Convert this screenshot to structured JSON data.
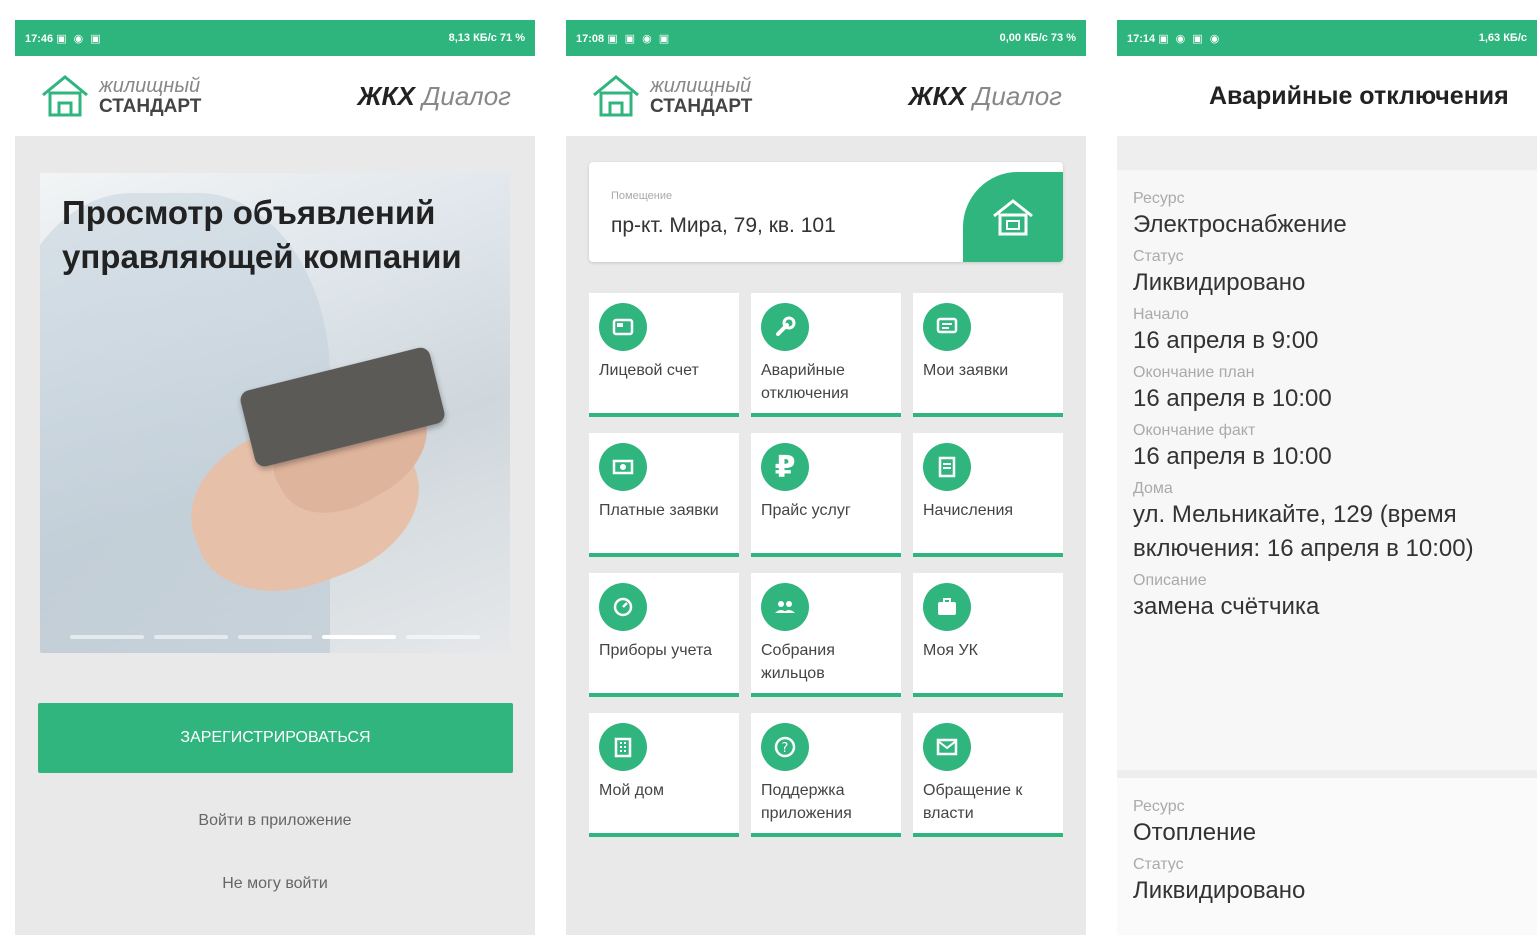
{
  "brand": {
    "color_primary": "#2fb57d",
    "logo_line1": "жилищный",
    "logo_line2": "СТАНДАРТ",
    "app_name_bold": "ЖКХ",
    "app_name_light": "Диалог"
  },
  "screen1": {
    "status_time": "17:46",
    "status_right": "8,13 КБ/с 71 %",
    "banner_title": "Просмотр объявлений управляющей компании",
    "register_button": "ЗАРЕГИСТРИРОВАТЬСЯ",
    "login_link": "Войти в приложение",
    "cant_login_link": "Не могу войти"
  },
  "screen2": {
    "status_time": "17:08",
    "status_right": "0,00 КБ/с 73 %",
    "address_label": "Помещение",
    "address_value": "пр-кт. Мира, 79,  кв. 101",
    "tiles": [
      {
        "label": "Лицевой счет",
        "icon": "wallet-icon"
      },
      {
        "label": "Аварийные отключения",
        "icon": "wrench-icon"
      },
      {
        "label": "Мои заявки",
        "icon": "chat-icon"
      },
      {
        "label": "Платные заявки",
        "icon": "money-icon"
      },
      {
        "label": "Прайс услуг",
        "icon": "ruble-icon"
      },
      {
        "label": "Начисления",
        "icon": "receipt-icon"
      },
      {
        "label": "Приборы учета",
        "icon": "meter-icon"
      },
      {
        "label": "Собрания жильцов",
        "icon": "people-icon"
      },
      {
        "label": "Моя УК",
        "icon": "briefcase-icon"
      },
      {
        "label": "Мой дом",
        "icon": "building-icon"
      },
      {
        "label": "Поддержка приложения",
        "icon": "help-icon"
      },
      {
        "label": "Обращение к власти",
        "icon": "mail-icon"
      }
    ]
  },
  "screen3": {
    "status_time": "17:14",
    "status_right": "1,63 КБ/с",
    "title": "Аварийные отключения",
    "cards": [
      {
        "fields": [
          {
            "label": "Ресурс",
            "value": "Электроснабжение"
          },
          {
            "label": "Статус",
            "value": "Ликвидировано"
          },
          {
            "label": "Начало",
            "value": "16 апреля в 9:00"
          },
          {
            "label": "Окончание план",
            "value": "16 апреля в 10:00"
          },
          {
            "label": "Окончание факт",
            "value": "16 апреля в 10:00"
          },
          {
            "label": "Дома",
            "value": "ул. Мельникайте, 129 (время включения: 16 апреля в 10:00)"
          },
          {
            "label": "Описание",
            "value": "замена счётчика"
          }
        ]
      },
      {
        "fields": [
          {
            "label": "Ресурс",
            "value": "Отопление"
          },
          {
            "label": "Статус",
            "value": "Ликвидировано"
          }
        ]
      }
    ]
  }
}
